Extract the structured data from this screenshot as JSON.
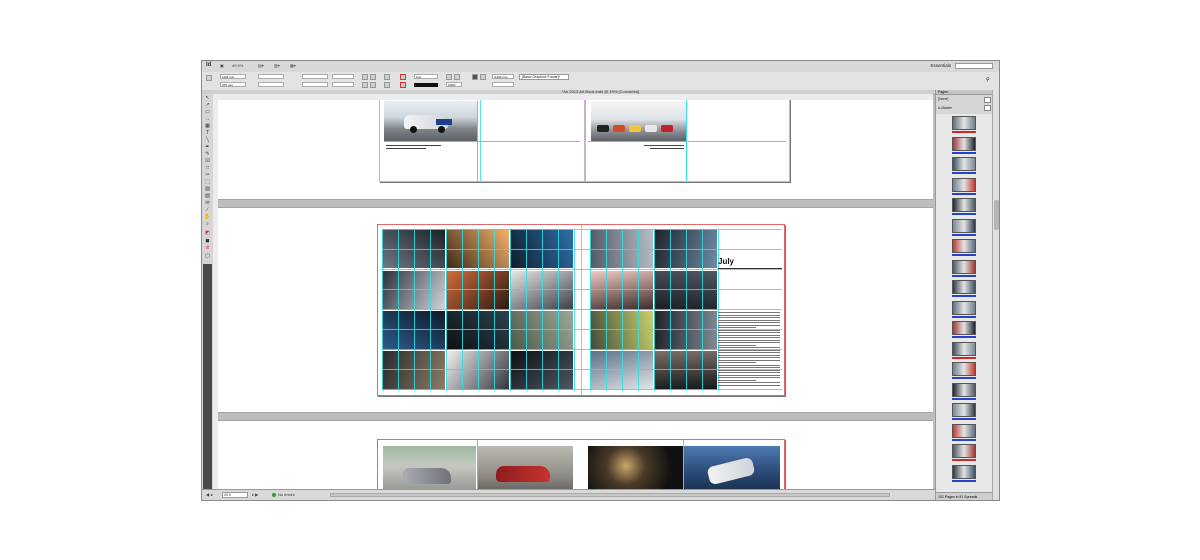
{
  "app": {
    "logo": "Id",
    "zoom": "49.9%",
    "workspace": "Essentials",
    "search_placeholder": ""
  },
  "control": {
    "x_value": "1104 mm",
    "y_value": "375 mm",
    "stroke_weight": "0 pt",
    "percent": "100%",
    "measure": "4.233 mm",
    "paragraph_style": "[Basic Graphics Frame]+"
  },
  "document": {
    "tab_title": "*Air 2013 Art Book.indd @ 49% [Converted]"
  },
  "status": {
    "zoom": "49.9",
    "errors": "No errors"
  },
  "pages_panel": {
    "header": "Pages",
    "masters": [
      "[None]",
      "A-Master"
    ],
    "footer": "102 Pages in 51 Spreads",
    "thumbs_count": 18
  },
  "spread2": {
    "month": "July"
  },
  "colors": {
    "guide": "#2fe0e6",
    "margin": "#c56ac8",
    "bleed": "#e24a4a"
  }
}
